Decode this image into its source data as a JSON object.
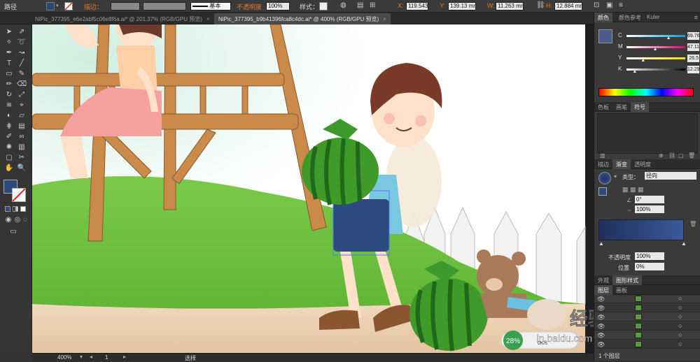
{
  "control_bar": {
    "tool_name": "路径",
    "stroke_label": "描边：",
    "stroke_style": "基本",
    "opacity_label": "不透明度",
    "opacity_value": "100%",
    "style_label": "样式：",
    "x_value": "119.543",
    "y_value": "139.13 mm",
    "w_value": "11.263 mm",
    "h_value": "12.884 mm",
    "fill_color": "#2a4a7a"
  },
  "tabs": [
    {
      "label": "NiPic_377395_e6e2abf5c06e8f6a.ai* @ 201.37% (RGB/GPU 预览)",
      "active": false
    },
    {
      "label": "NiPic_377395_b9b41396fca8c4dc.ai* @ 400% (RGB/GPU 预览)",
      "active": true
    }
  ],
  "toolbox": {
    "fill_color": "#2c4a7c",
    "tools": [
      "selection-tool-icon",
      "direct-selection-tool-icon",
      "magic-wand-icon",
      "lasso-icon",
      "pen-tool-icon",
      "curvature-icon",
      "type-tool-icon",
      "line-tool-icon",
      "rectangle-tool-icon",
      "paintbrush-icon",
      "pencil-icon",
      "eraser-icon",
      "rotate-icon",
      "scale-icon",
      "width-tool-icon",
      "free-transform-icon",
      "shape-builder-icon",
      "perspective-icon",
      "mesh-icon",
      "gradient-icon",
      "eyedropper-icon",
      "blend-icon",
      "symbol-sprayer-icon",
      "graph-icon",
      "artboard-icon",
      "slice-icon",
      "hand-icon",
      "zoom-icon"
    ]
  },
  "color_panel": {
    "tabs": [
      "颜色",
      "颜色参考",
      "Kuler"
    ],
    "swatch": "#4a5a8a",
    "channels": [
      {
        "name": "C",
        "value": "69.76",
        "level": 0.6976,
        "grad_from": "#ffffff",
        "grad_to": "#00a0e0"
      },
      {
        "name": "M",
        "value": "47.11",
        "level": 0.4711,
        "grad_from": "#ffffff",
        "grad_to": "#e0007a"
      },
      {
        "name": "Y",
        "value": "26.5",
        "level": 0.265,
        "grad_from": "#ffffff",
        "grad_to": "#f0e000"
      },
      {
        "name": "K",
        "value": "12.29",
        "level": 0.1229,
        "grad_from": "#ffffff",
        "grad_to": "#000000"
      }
    ]
  },
  "swatches_panel": {
    "tabs": [
      "色板",
      "画笔",
      "符号"
    ]
  },
  "gradient_panel": {
    "tabs": [
      "描边",
      "渐变",
      "透明度"
    ],
    "type_label": "类型：",
    "type_value": "径向",
    "angle_value": "0°",
    "ratio_value": "100%",
    "opacity_label": "不透明度",
    "opacity_value": "100%",
    "position_label": "位置",
    "position_value": "0%",
    "gradient_from": "#1f2f5c",
    "gradient_to": "#3a5a9a"
  },
  "appearance_panel": {
    "tabs": [
      "外观",
      "图形样式"
    ]
  },
  "layers_panel": {
    "tabs": [
      "图层",
      "画板"
    ],
    "rows": 6,
    "footer": "1 个图层"
  },
  "status_bar": {
    "zoom": "400%",
    "page": "1",
    "tool": "选择"
  },
  "canvas": {
    "progress_value": 28,
    "progress_label": "28%",
    "speed_label": "0K/s",
    "watermark_line1": "经验",
    "watermark_line2": "in.baidu.com"
  }
}
